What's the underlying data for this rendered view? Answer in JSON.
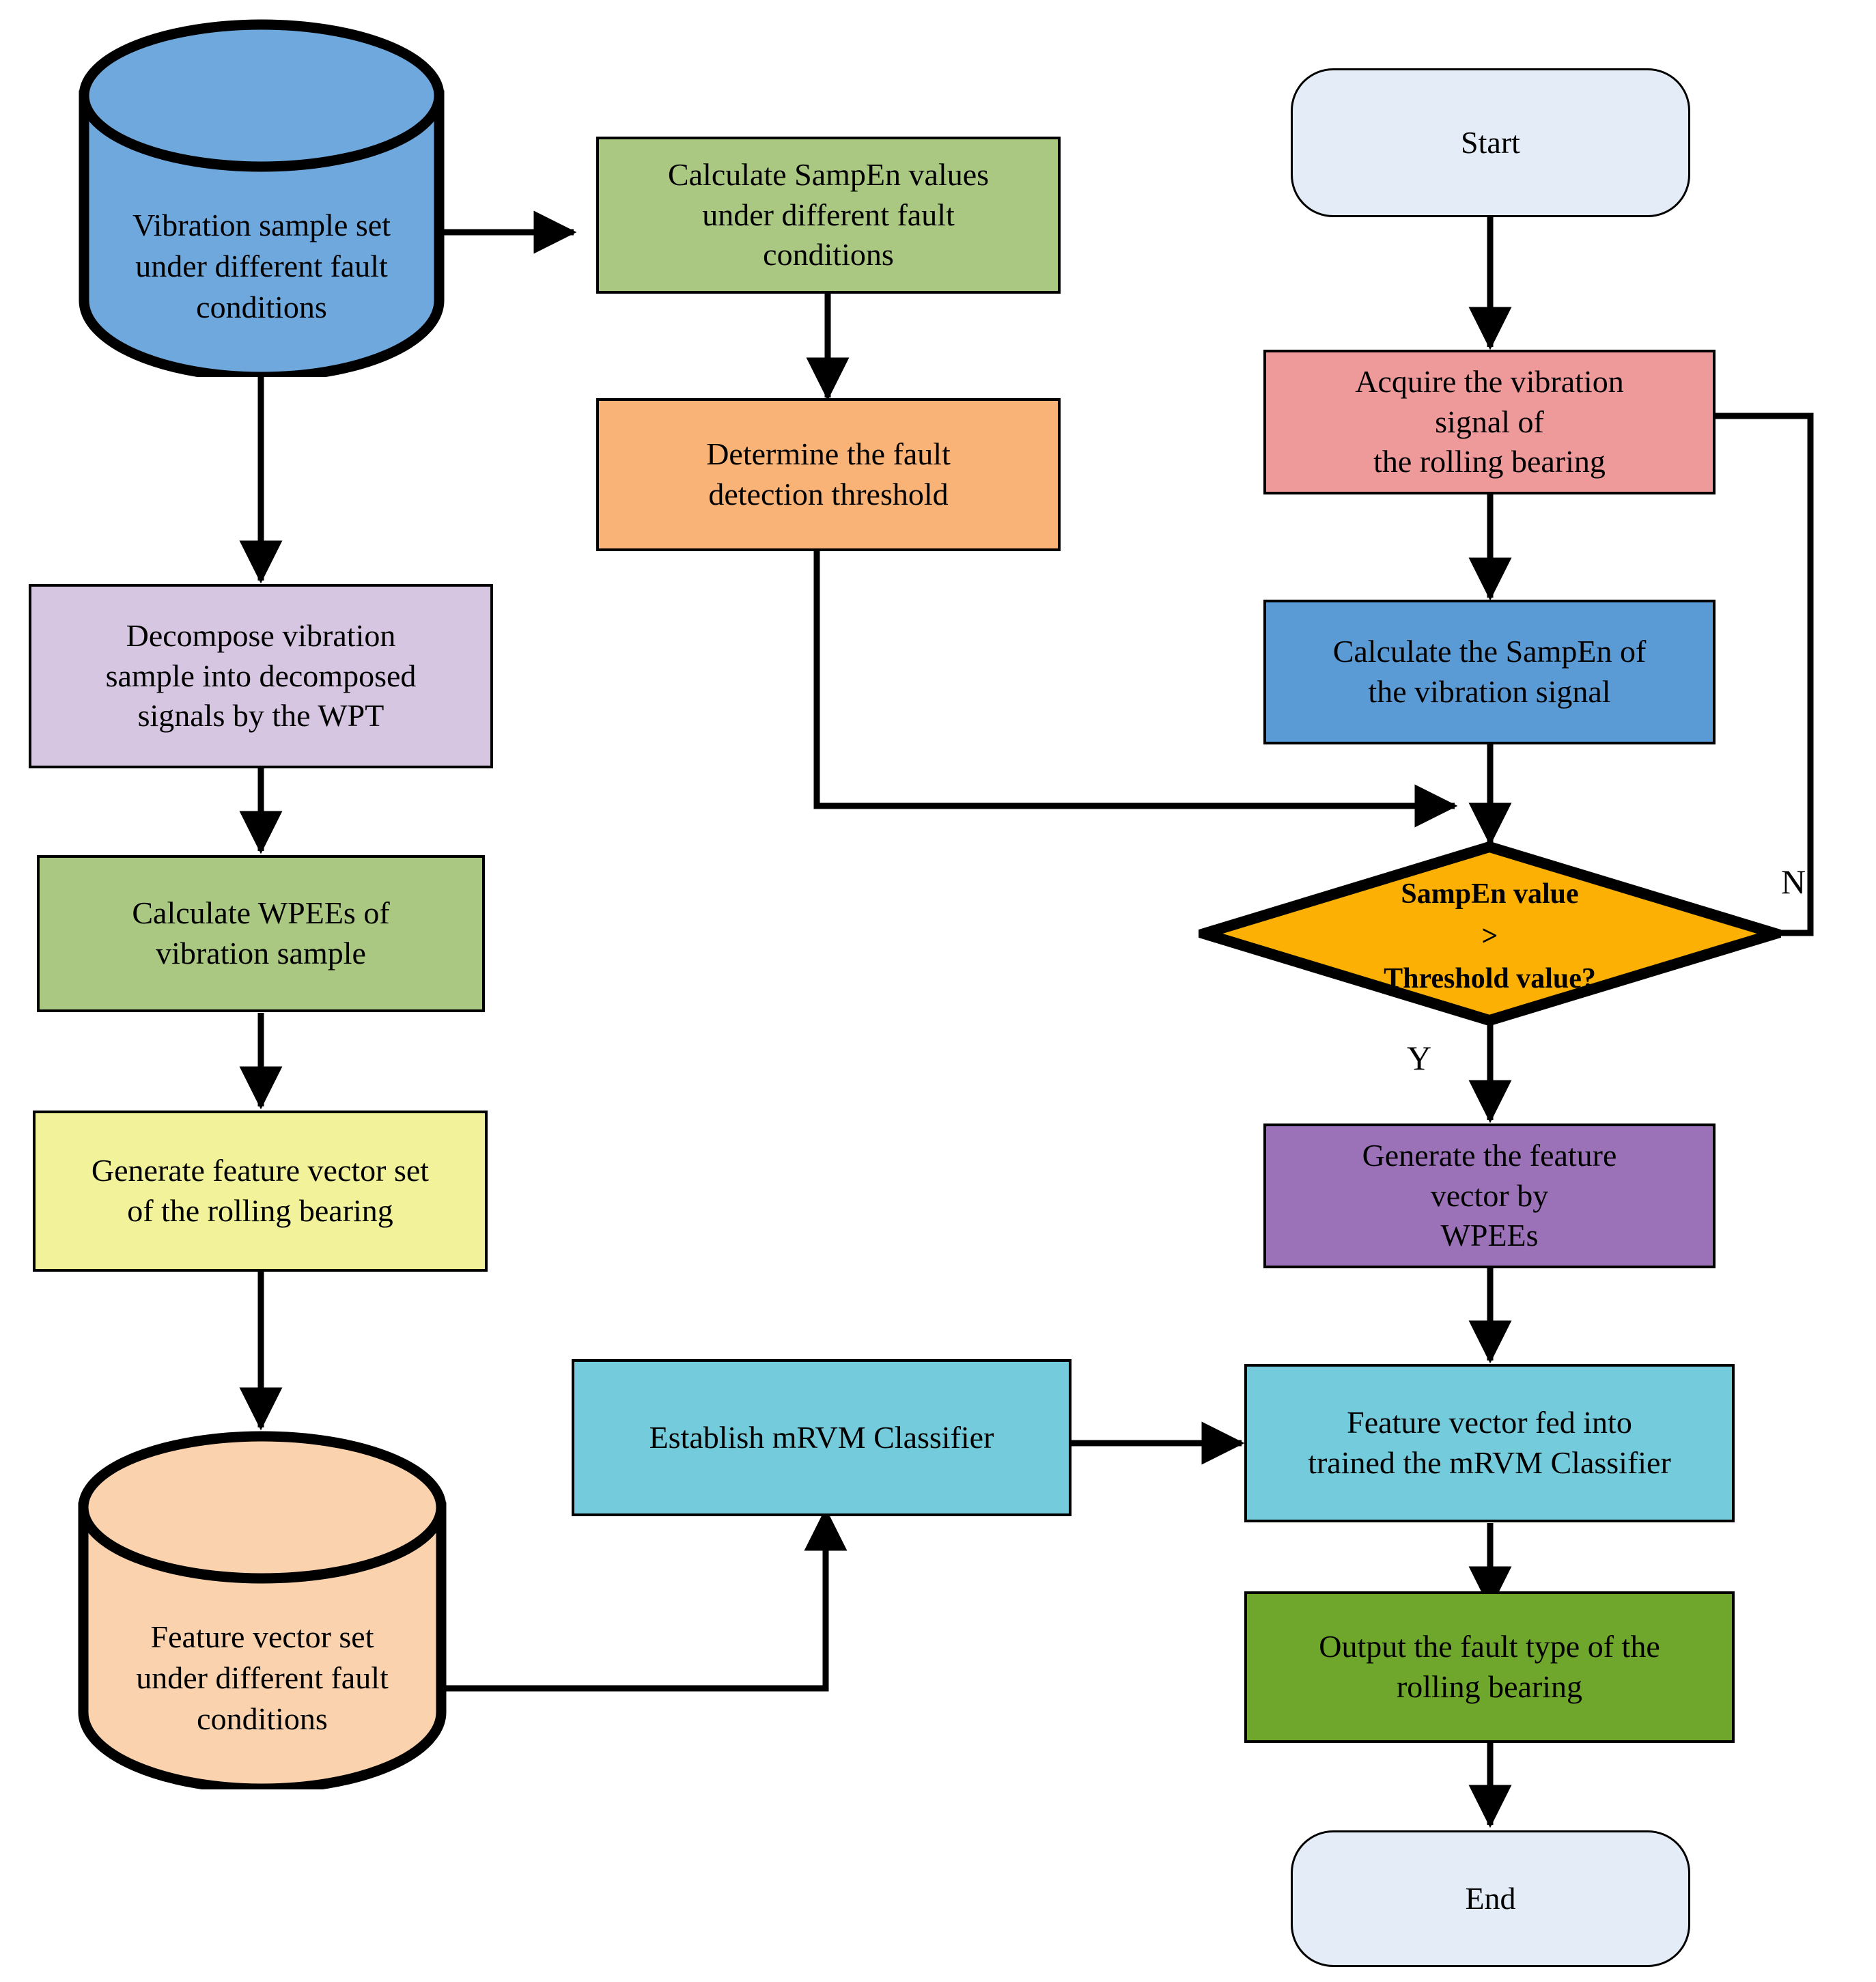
{
  "diagram": {
    "type": "flowchart",
    "title": "Rolling bearing fault detection and diagnosis flowchart",
    "colors": {
      "stroke": "#000000",
      "cylinder_blue": "#6fa8dc",
      "box_green_light": "#aac882",
      "box_orange": "#fab377",
      "box_lavender": "#d7c6e2",
      "box_yellow": "#f2f29a",
      "cylinder_peach": "#fbd2ae",
      "box_cyan": "#74cbdc",
      "terminator_blue": "#e3ecf7",
      "box_red": "#ef9a9a",
      "box_blue": "#5b9bd5",
      "diamond_amber": "#fbb003",
      "box_purple": "#9b72b8",
      "box_green_dark": "#6fa72c"
    }
  },
  "nodes": {
    "vibration_sample_set": {
      "label": "Vibration sample set\nunder different fault\nconditions",
      "shape": "cylinder",
      "color": "#6fa8dc"
    },
    "calculate_sampen_values": {
      "label": "Calculate SampEn values\nunder different fault\nconditions",
      "shape": "rect",
      "color": "#aac882"
    },
    "determine_threshold": {
      "label": "Determine the fault\ndetection threshold",
      "shape": "rect",
      "color": "#fab377"
    },
    "start": {
      "label": "Start",
      "shape": "terminator",
      "color": "#e3ecf7"
    },
    "acquire_vibration_signal": {
      "label": "Acquire the vibration\nsignal of\nthe rolling bearing",
      "shape": "rect",
      "color": "#ef9a9a"
    },
    "calculate_sampen_signal": {
      "label": "Calculate the SampEn of\nthe vibration signal",
      "shape": "rect",
      "color": "#5b9bd5"
    },
    "decompose_vibration": {
      "label": "Decompose vibration\nsample into decomposed\nsignals  by the WPT",
      "shape": "rect",
      "color": "#d7c6e2"
    },
    "calculate_wpees": {
      "label": "Calculate WPEEs of\nvibration sample",
      "shape": "rect",
      "color": "#aac882"
    },
    "decision_sampen": {
      "label_line1": "SampEn value",
      "label_line2": ">",
      "label_line3": "Threshold value?",
      "shape": "diamond",
      "color": "#fbb003"
    },
    "generate_feature_vector_set": {
      "label": "Generate feature vector set\nof the rolling bearing",
      "shape": "rect",
      "color": "#f2f29a"
    },
    "generate_feature_vector": {
      "label": "Generate the feature\nvector by\nWPEEs",
      "shape": "rect",
      "color": "#9b72b8"
    },
    "feature_vector_set": {
      "label": "Feature vector set\nunder different fault\nconditions",
      "shape": "cylinder",
      "color": "#fbd2ae"
    },
    "establish_mrvm": {
      "label": "Establish mRVM Classifier",
      "shape": "rect",
      "color": "#74cbdc"
    },
    "feature_vector_fed": {
      "label": "Feature vector fed into\ntrained the mRVM Classifier",
      "shape": "rect",
      "color": "#74cbdc"
    },
    "output_fault_type": {
      "label": "Output the fault type of the\nrolling bearing",
      "shape": "rect",
      "color": "#6fa72c"
    },
    "end": {
      "label": "End",
      "shape": "terminator",
      "color": "#e3ecf7"
    }
  },
  "edge_labels": {
    "no_branch": "N",
    "yes_branch": "Y"
  }
}
